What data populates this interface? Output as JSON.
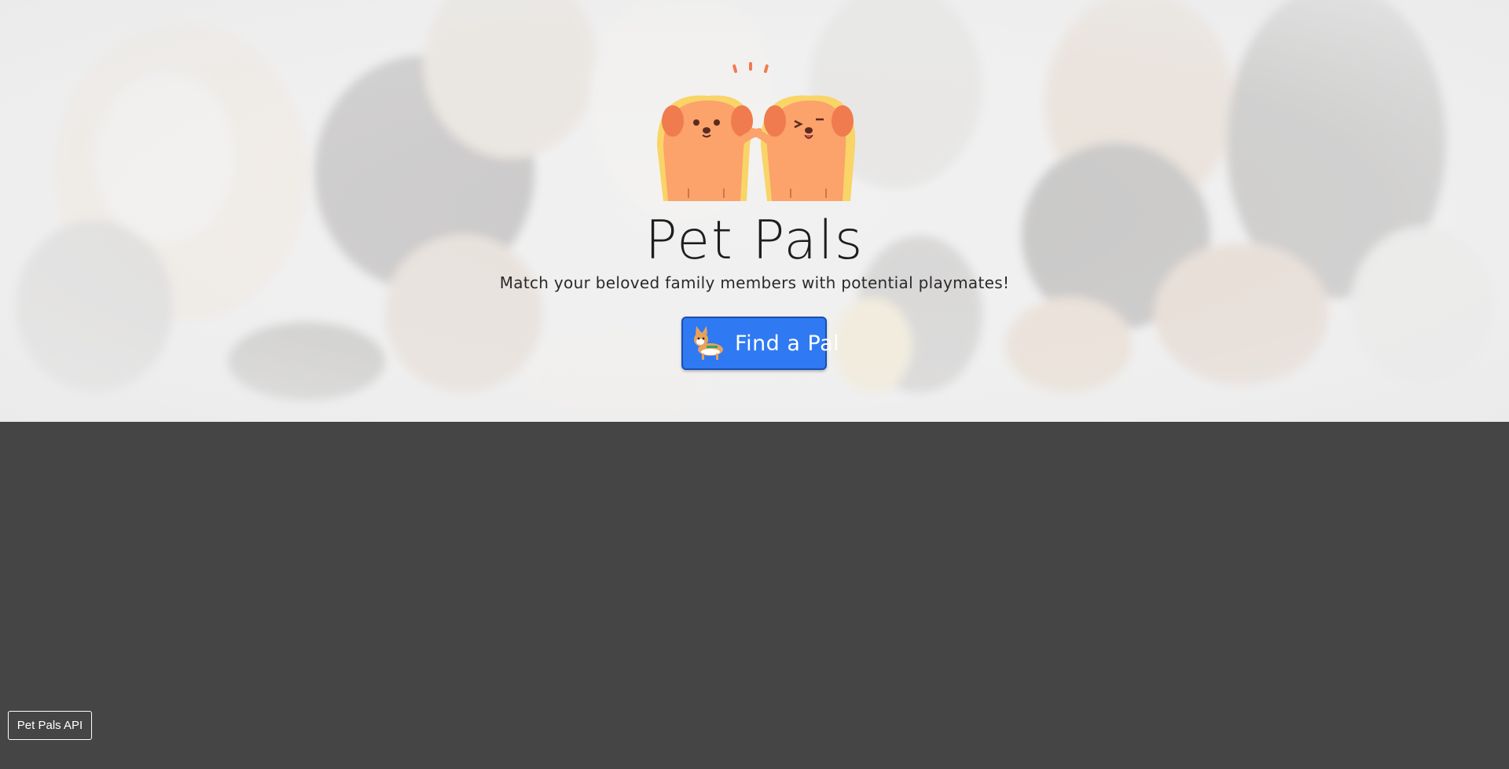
{
  "hero": {
    "title": "Pet Pals",
    "subtitle": "Match your beloved family members with potential playmates!",
    "cta_label": "Find a Pal",
    "cta_icon": "corgi-icon",
    "mascot": "two-puppies-high-five-logo"
  },
  "footer": {
    "api_button_label": "Pet Pals API"
  },
  "colors": {
    "page_background": "#454545",
    "hero_background": "#ebebeb",
    "cta_background": "#2f79f3",
    "mascot_orange": "#fca26b",
    "mascot_yellow": "#f9d467"
  }
}
